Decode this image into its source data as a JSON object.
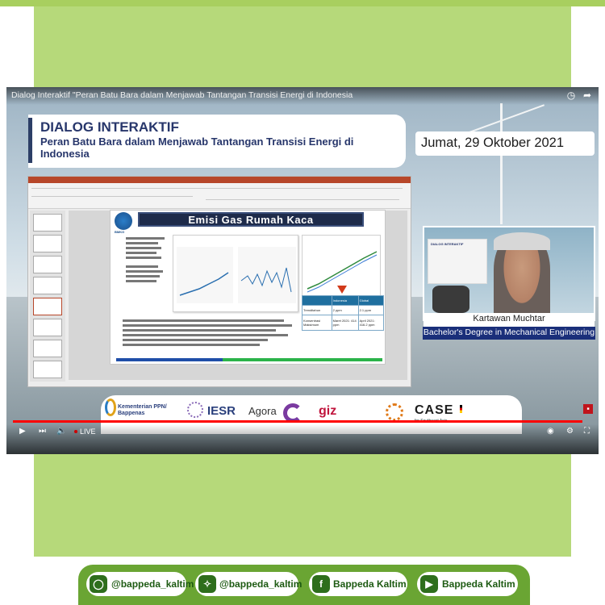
{
  "video": {
    "title": "Dialog Interaktif \"Peran Batu Bara dalam Menjawab Tantangan Transisi Energi di Indonesia",
    "event_label": "DIALOG INTERAKTIF",
    "event_subtitle": "Peran Batu Bara dalam Menjawab Tantangan Transisi Energi di Indonesia",
    "date": "Jumat, 29 Oktober 2021",
    "live_label": "LIVE",
    "progress": 1.0,
    "icons": [
      "clock-icon",
      "share-icon",
      "play-icon",
      "next-icon",
      "volume-icon",
      "settings-icon",
      "fullscreen-icon"
    ]
  },
  "slide": {
    "heading": "Emisi Gas Rumah Kaca",
    "logo_label": "BMKG",
    "table": {
      "headers": [
        "",
        "Indonesia",
        "Global"
      ],
      "rows": [
        [
          "Trenditahun",
          "2 ppm",
          "2.1 ppm"
        ],
        [
          "Konsentrasi Maksimum",
          "Maret 2021: 414 ppm",
          "April 2021: 416.2 ppm"
        ]
      ]
    }
  },
  "presenter": {
    "name": "Kartawan Muchtar",
    "title": "Bachelor's Degree in Mechanical Engineering",
    "slide_title": "DIALOG INTERAKTIF"
  },
  "sponsors": {
    "kementerian": "Kementerian PPN/ Bappenas",
    "iesr": "IESR",
    "agora": "Agora",
    "giz": "giz",
    "case": "CASE",
    "case_sub": "for Southeast Asia"
  },
  "social": [
    {
      "icon": "instagram-icon",
      "label": "@bappeda_kaltim"
    },
    {
      "icon": "twitter-icon",
      "label": "@bappeda_kaltim"
    },
    {
      "icon": "facebook-icon",
      "label": "Bappeda Kaltim"
    },
    {
      "icon": "youtube-icon",
      "label": "Bappeda Kaltim"
    }
  ],
  "colors": {
    "green_panel": "#b6d97a",
    "social_bar": "#6aa533",
    "title_navy": "#27366b",
    "degree_band": "#1a2f7a",
    "progress_red": "#ff0000"
  }
}
